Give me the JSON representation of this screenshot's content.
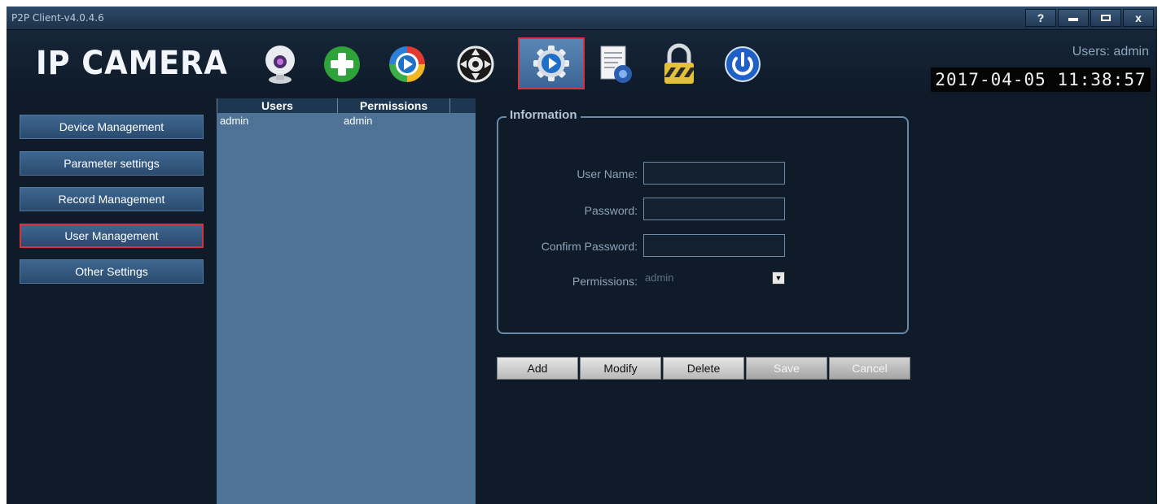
{
  "window": {
    "title": "P2P Client-v4.0.4.6",
    "help": "?",
    "close": "x"
  },
  "header": {
    "logo": "IP CAMERA",
    "tools": [
      {
        "name": "webcam-icon"
      },
      {
        "name": "add-device-icon"
      },
      {
        "name": "playback-icon"
      },
      {
        "name": "ptz-control-icon"
      },
      {
        "name": "settings-icon",
        "selected": true
      },
      {
        "name": "log-document-icon"
      },
      {
        "name": "lock-icon"
      },
      {
        "name": "power-icon"
      }
    ],
    "users_label": "Users: admin",
    "datetime": "2017-04-05 11:38:57"
  },
  "sidebar": {
    "items": [
      {
        "label": "Device Management"
      },
      {
        "label": "Parameter settings"
      },
      {
        "label": "Record Management"
      },
      {
        "label": "User Management",
        "active": true
      },
      {
        "label": "Other Settings"
      }
    ]
  },
  "userlist": {
    "columns": [
      "Users",
      "Permissions"
    ],
    "rows": [
      {
        "user": "admin",
        "permission": "admin"
      }
    ]
  },
  "info": {
    "legend": "Information",
    "user_name_label": "User Name:",
    "password_label": "Password:",
    "confirm_label": "Confirm Password:",
    "permissions_label": "Permissions:",
    "permissions_value": "admin"
  },
  "actions": {
    "add": "Add",
    "modify": "Modify",
    "delete": "Delete",
    "save": "Save",
    "cancel": "Cancel"
  },
  "colors": {
    "selection_border": "#d8323a",
    "list_bg": "#4e7396",
    "panel_bg": "#0f1b29"
  }
}
